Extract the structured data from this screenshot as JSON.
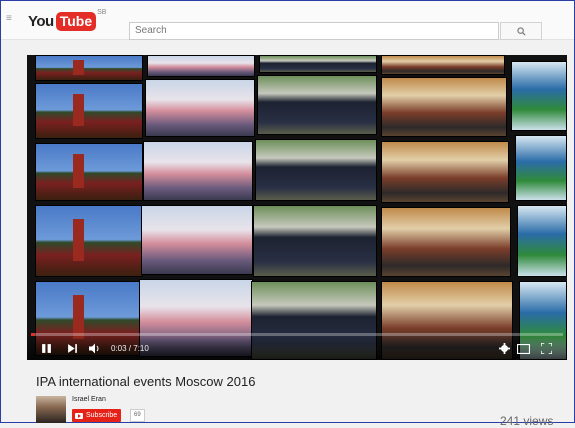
{
  "header": {
    "logo_you": "You",
    "logo_tube": "Tube",
    "logo_region": "SB",
    "search_placeholder": "Search"
  },
  "player": {
    "time_text": "0:03 / 7:10",
    "progress": 0.007
  },
  "video": {
    "title": "IPA international events Moscow 2016",
    "channel_name": "Israel Eran",
    "subscribe_label": "Subscribe",
    "subscriber_count": "69",
    "views": "241 views"
  },
  "colors": {
    "brand_red": "#e52d27",
    "subscribe_red": "#e62117",
    "window_border": "#2a3ea5"
  },
  "icons": [
    "menu-icon",
    "search-icon",
    "play-icon",
    "next-icon",
    "volume-icon",
    "settings-icon",
    "theater-icon",
    "fullscreen-icon",
    "youtube-icon"
  ]
}
